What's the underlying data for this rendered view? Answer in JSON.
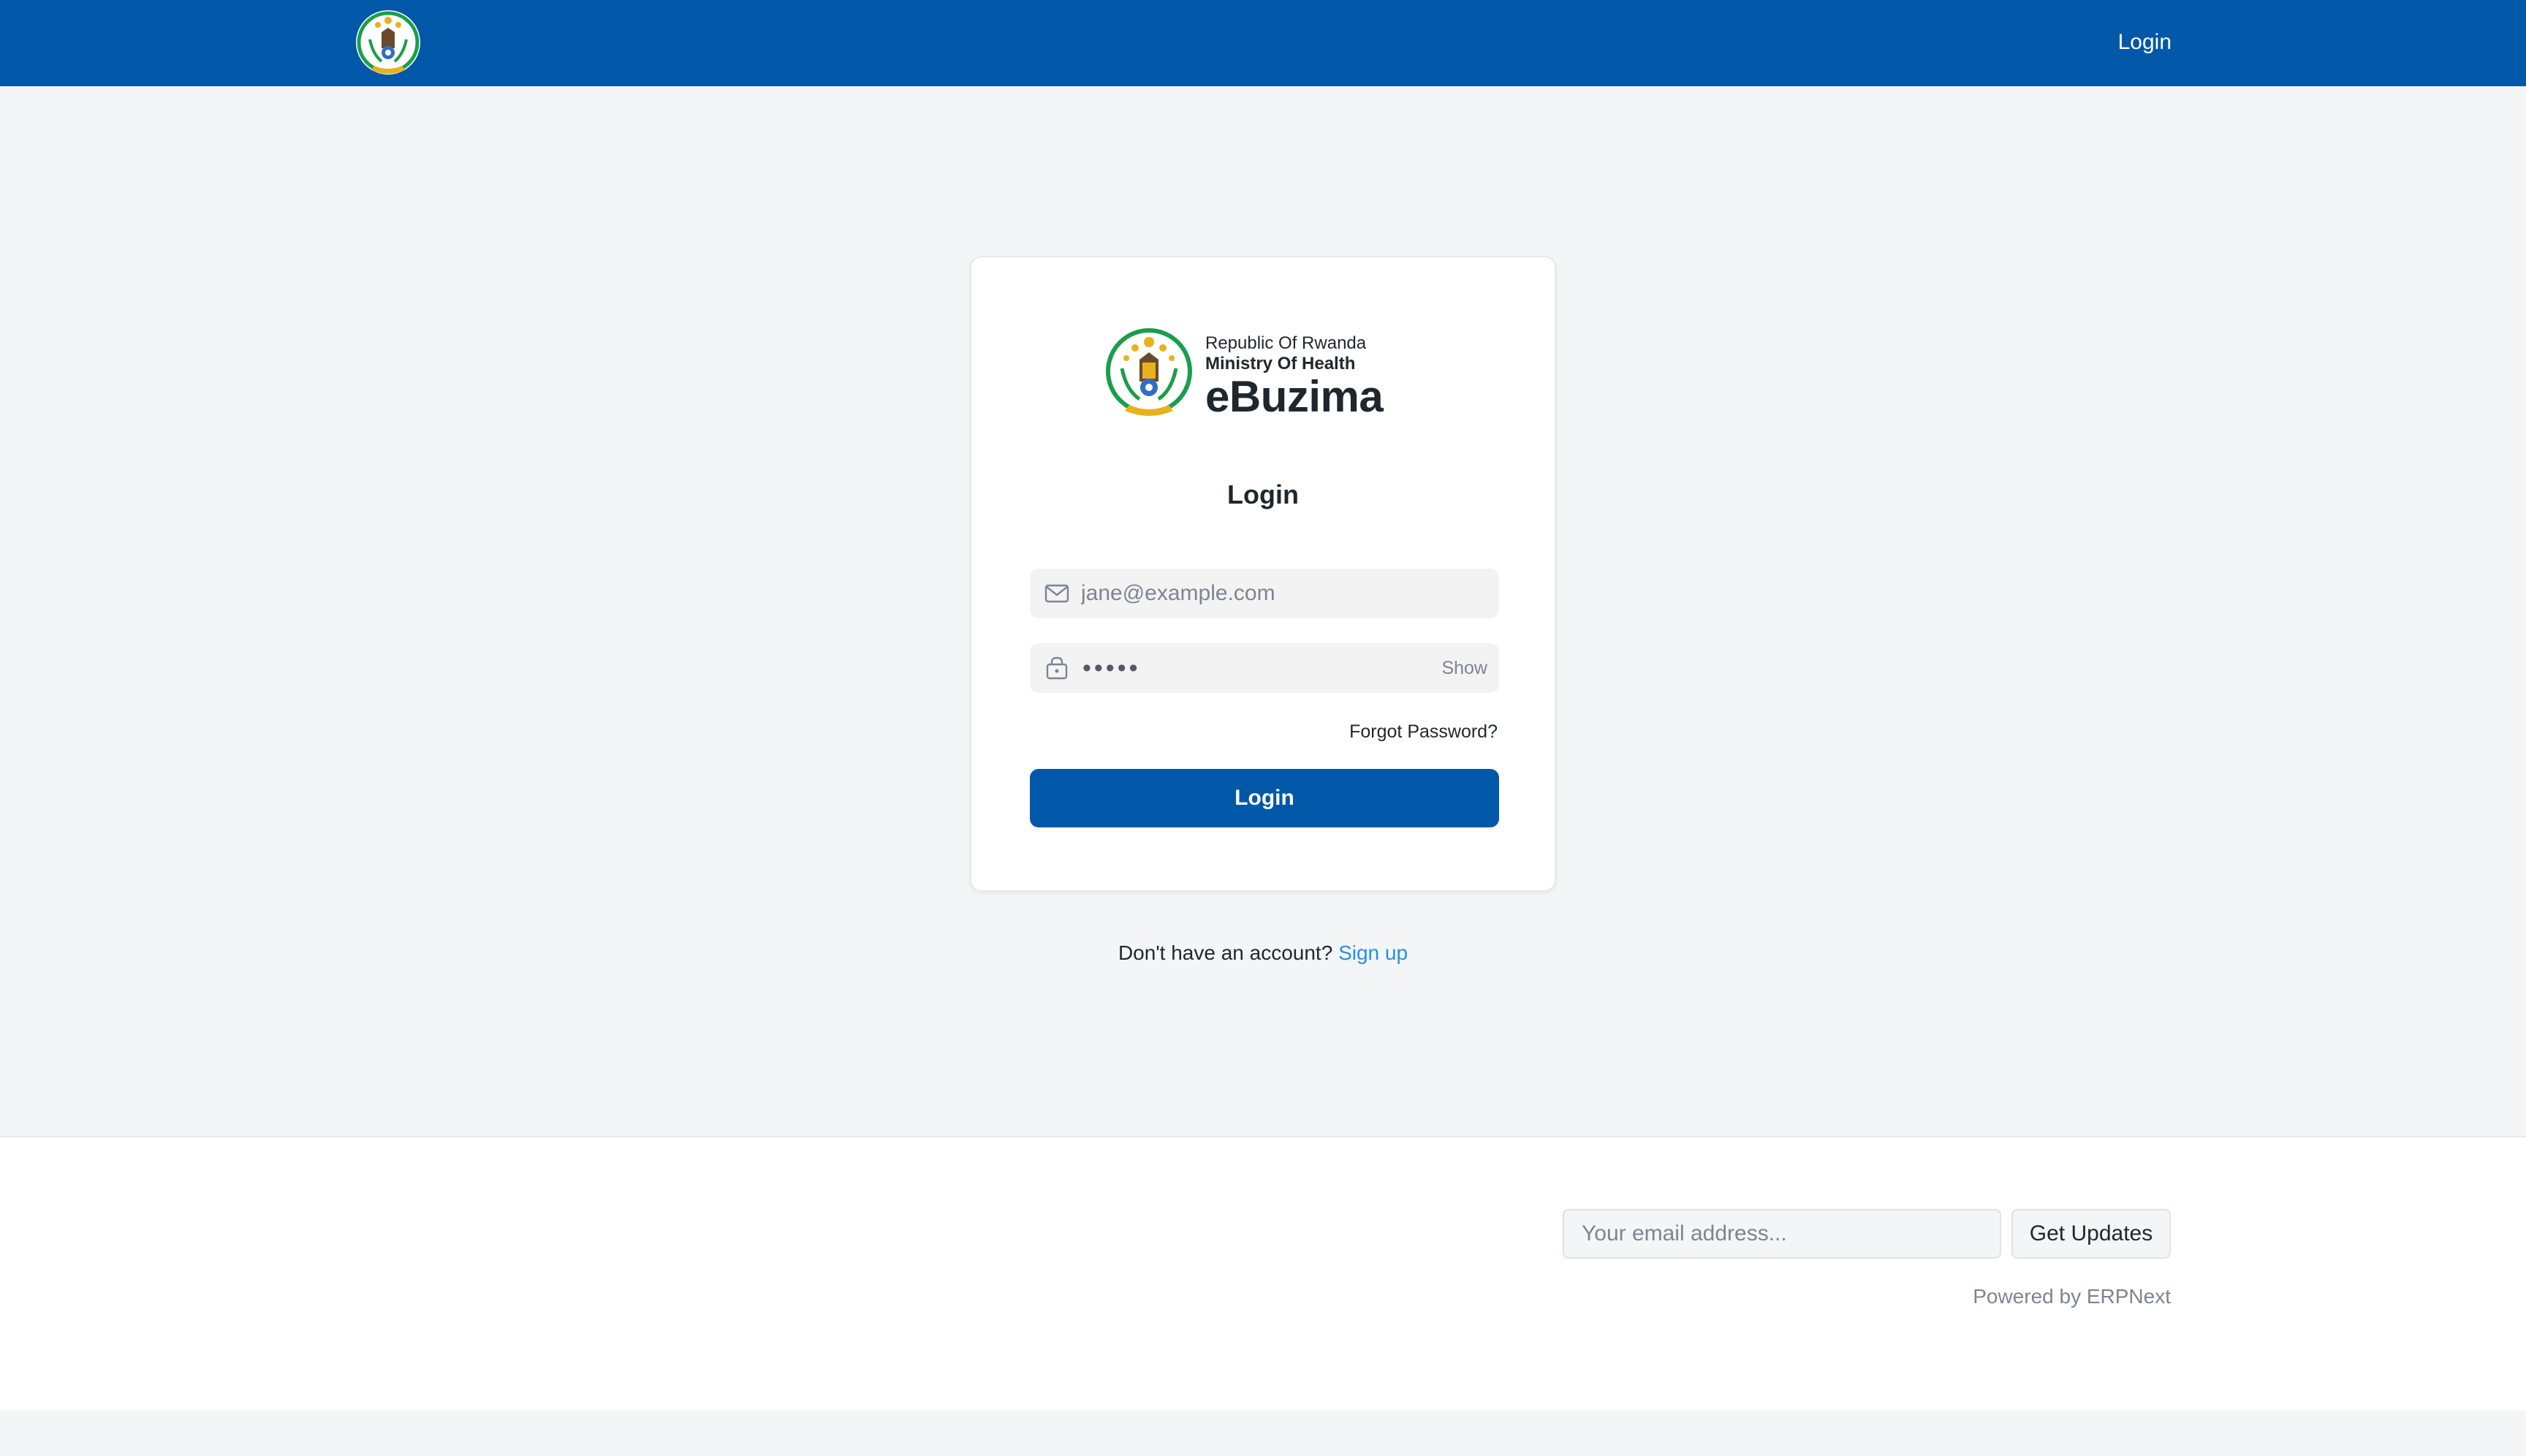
{
  "navbar": {
    "login_label": "Login",
    "logo_icon": "rwanda-coat-of-arms-icon",
    "background_color": "#0158a8"
  },
  "card": {
    "brand": {
      "republic": "Republic Of Rwanda",
      "ministry": "Ministry Of Health",
      "app_name": "eBuzima",
      "emblem_icon": "rwanda-coat-of-arms-icon"
    },
    "title": "Login",
    "email": {
      "placeholder": "jane@example.com",
      "icon": "mail-icon"
    },
    "password": {
      "masked_value": "•••••",
      "show_label": "Show",
      "icon": "lock-icon"
    },
    "forgot_password": "Forgot Password?",
    "login_button": "Login",
    "accent_color": "#0158a8"
  },
  "signup": {
    "prompt": "Don't have an account?",
    "link_label": "Sign up",
    "link_color": "#2490ef"
  },
  "footer": {
    "email_placeholder": "Your email address...",
    "get_updates_label": "Get Updates",
    "powered_by": "Powered by ERPNext"
  }
}
